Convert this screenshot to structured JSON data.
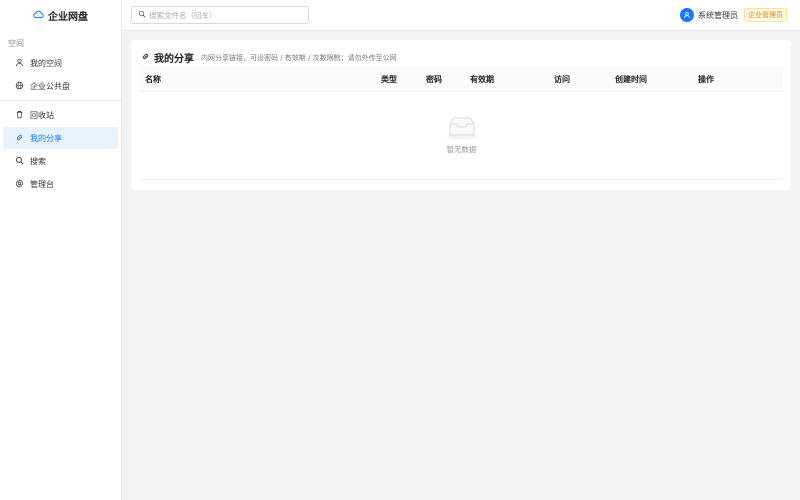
{
  "app": {
    "title": "企业网盘"
  },
  "sidebar": {
    "section_label": "空间",
    "items": [
      {
        "label": "我的空间",
        "icon": "user-icon",
        "active": false
      },
      {
        "label": "企业公共盘",
        "icon": "globe-icon",
        "active": false
      },
      {
        "label": "回收站",
        "icon": "trash-icon",
        "active": false
      },
      {
        "label": "我的分享",
        "icon": "link-icon",
        "active": true
      },
      {
        "label": "搜索",
        "icon": "search-icon",
        "active": false
      },
      {
        "label": "管理台",
        "icon": "gear-icon",
        "active": false
      }
    ]
  },
  "topbar": {
    "search_placeholder": "搜索文件名（回车）",
    "user_name": "系统管理员",
    "role": "企业管理员"
  },
  "page": {
    "title": "我的分享",
    "description": "内网分享链接，可设密码 / 有效期 / 次数限制；请勿外传至公网",
    "columns": [
      "名称",
      "类型",
      "密码",
      "有效期",
      "访问",
      "创建时间",
      "操作"
    ],
    "empty_text": "暂无数据"
  },
  "colors": {
    "accent": "#1677ff",
    "active_bg": "#e8f2fd",
    "badge": "#d48806"
  }
}
